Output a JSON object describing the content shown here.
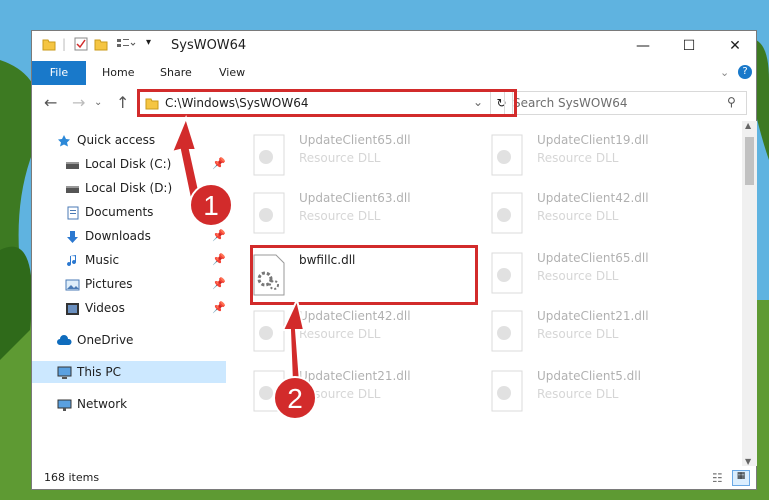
{
  "window": {
    "title": "SysWOW64"
  },
  "ribbon": {
    "tabs": [
      "File",
      "Home",
      "Share",
      "View"
    ]
  },
  "address": {
    "path": "C:\\Windows\\SysWOW64"
  },
  "search": {
    "placeholder": "Search SysWOW64"
  },
  "sidebar": {
    "items": [
      {
        "label": "Quick access",
        "icon": "star-icon"
      },
      {
        "label": "Local Disk (C:)",
        "icon": "drive-icon",
        "pinned": true
      },
      {
        "label": "Local Disk (D:)",
        "icon": "drive-icon"
      },
      {
        "label": "Documents",
        "icon": "documents-icon",
        "pinned": true
      },
      {
        "label": "Downloads",
        "icon": "download-icon",
        "pinned": true
      },
      {
        "label": "Music",
        "icon": "music-icon",
        "pinned": true
      },
      {
        "label": "Pictures",
        "icon": "pictures-icon",
        "pinned": true
      },
      {
        "label": "Videos",
        "icon": "videos-icon",
        "pinned": true
      },
      {
        "label": "OneDrive",
        "icon": "cloud-icon"
      },
      {
        "label": "This PC",
        "icon": "computer-icon",
        "selected": true
      },
      {
        "label": "Network",
        "icon": "network-icon"
      }
    ]
  },
  "files": [
    {
      "name": "UpdateClient65.dll",
      "type": "Resource DLL"
    },
    {
      "name": "UpdateClient19.dll",
      "type": "Resource DLL"
    },
    {
      "name": "UpdateClient63.dll",
      "type": "Resource DLL"
    },
    {
      "name": "UpdateClient42.dll",
      "type": "Resource DLL"
    },
    {
      "name": "bwfillc.dll",
      "type": ""
    },
    {
      "name": "UpdateClient65.dll",
      "type": "Resource DLL"
    },
    {
      "name": "UpdateClient42.dll",
      "type": "Resource DLL"
    },
    {
      "name": "UpdateClient21.dll",
      "type": "Resource DLL"
    },
    {
      "name": "UpdateClient21.dll",
      "type": "Resource DLL"
    },
    {
      "name": "UpdateClient5.dll",
      "type": "Resource DLL"
    }
  ],
  "status": {
    "items": "168 items"
  },
  "annotations": {
    "step1": "1",
    "step2": "2"
  },
  "colors": {
    "accent": "#1979ca",
    "highlight": "#d22b2b",
    "selected": "#cce8ff"
  }
}
